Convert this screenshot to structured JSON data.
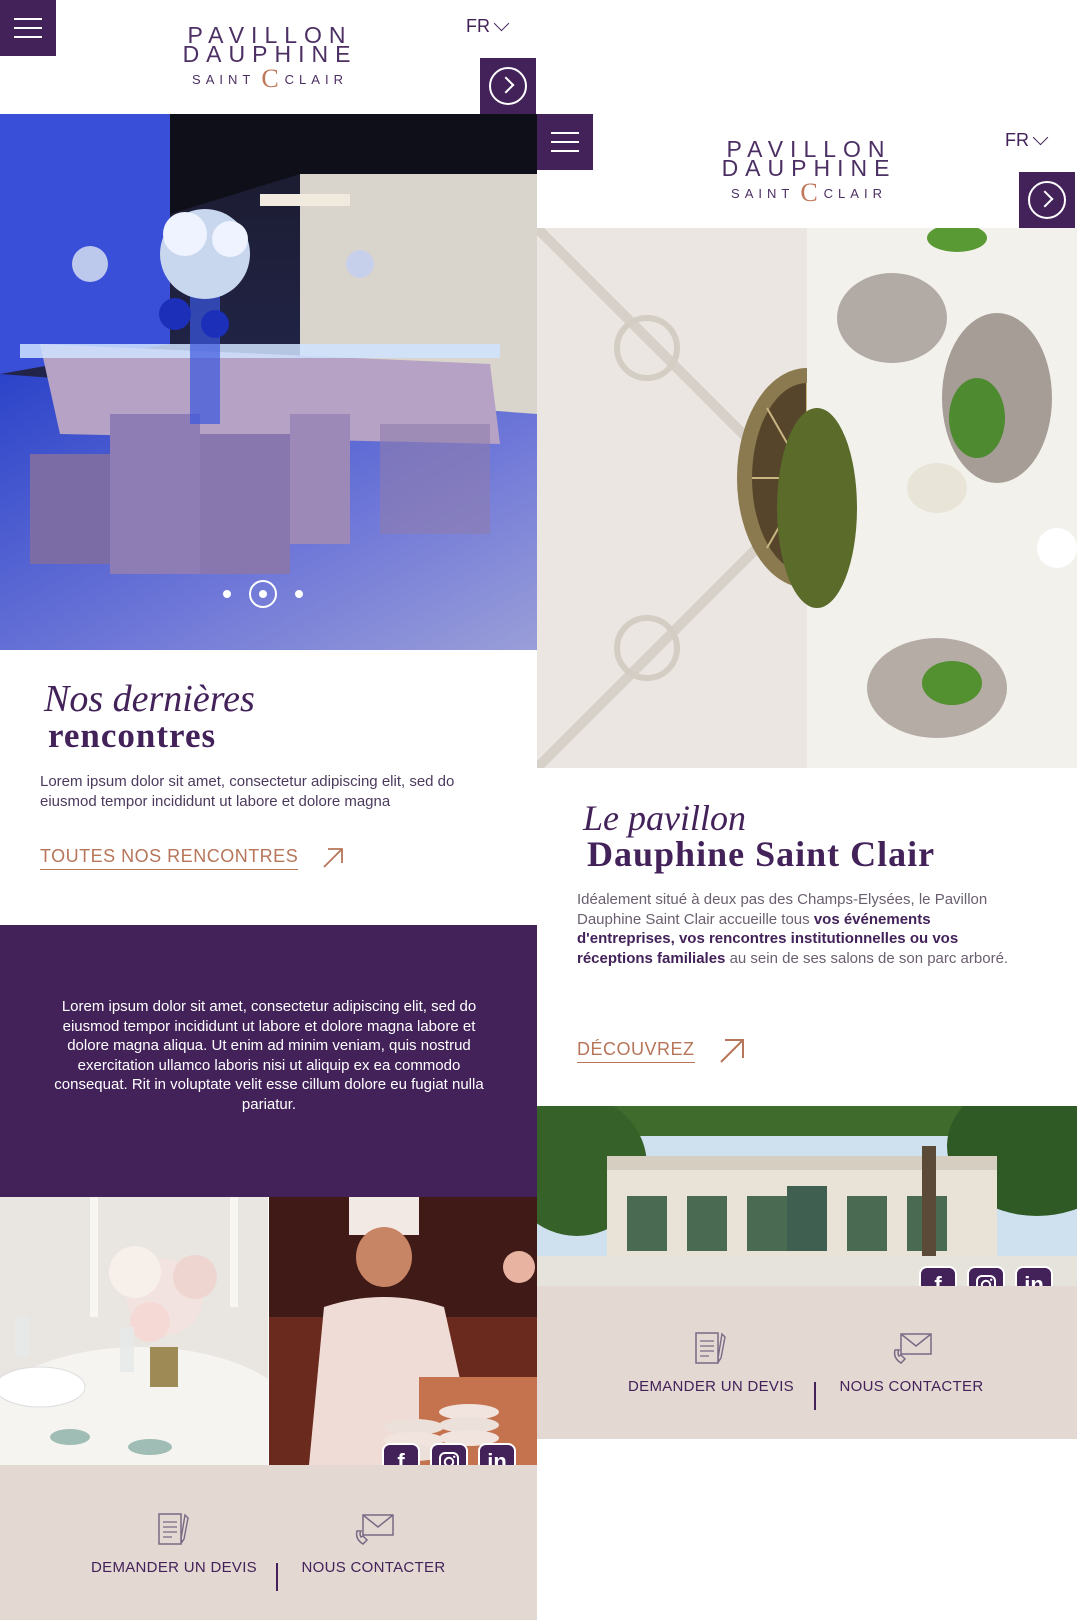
{
  "brand": {
    "line1": "PAVILLON",
    "line2": "DAUPHINE",
    "line3_left": "SAINT",
    "line3_right": "CLAIR",
    "ampersand": "C"
  },
  "header": {
    "lang": "FR"
  },
  "left": {
    "slider": {
      "dots": 3,
      "active_dot": 2
    },
    "section": {
      "title_italic": "Nos dernières",
      "title_bold": "rencontres",
      "text": "Lorem ipsum dolor sit amet, consectetur adipiscing elit, sed do eiusmod tempor incididunt ut labore et dolore magna",
      "cta": "TOUTES NOS RENCONTRES"
    },
    "purple_text": "Lorem ipsum dolor sit amet, consectetur adipiscing elit, sed do eiusmod tempor incididunt ut labore et dolore magna labore et dolore magna aliqua. Ut enim ad minim veniam, quis nostrud exercitation ullamco laboris nisi ut aliquip ex ea commodo consequat. Rit in voluptate velit esse cillum dolore eu fugiat nulla pariatur."
  },
  "right": {
    "section": {
      "title_italic": "Le pavillon",
      "title_bold": "Dauphine Saint Clair",
      "text_1": "Idéalement situé à deux pas des Champs-Elysées, le Pavillon Dauphine Saint Clair accueille tous ",
      "text_bold": "vos événements d'entreprises, vos rencontres institutionnelles ou vos réceptions familiales",
      "text_2": " au sein de ses salons de son parc arboré.",
      "cta": "DÉCOUVREZ"
    }
  },
  "social": {
    "facebook": "f",
    "instagram": "instagram-icon",
    "linkedin": "in"
  },
  "footer": {
    "quote": "DEMANDER UN DEVIS",
    "contact": "NOUS CONTACTER"
  },
  "colors": {
    "accent": "#43225a",
    "copper": "#b77559",
    "beige": "#e3d8d2"
  }
}
